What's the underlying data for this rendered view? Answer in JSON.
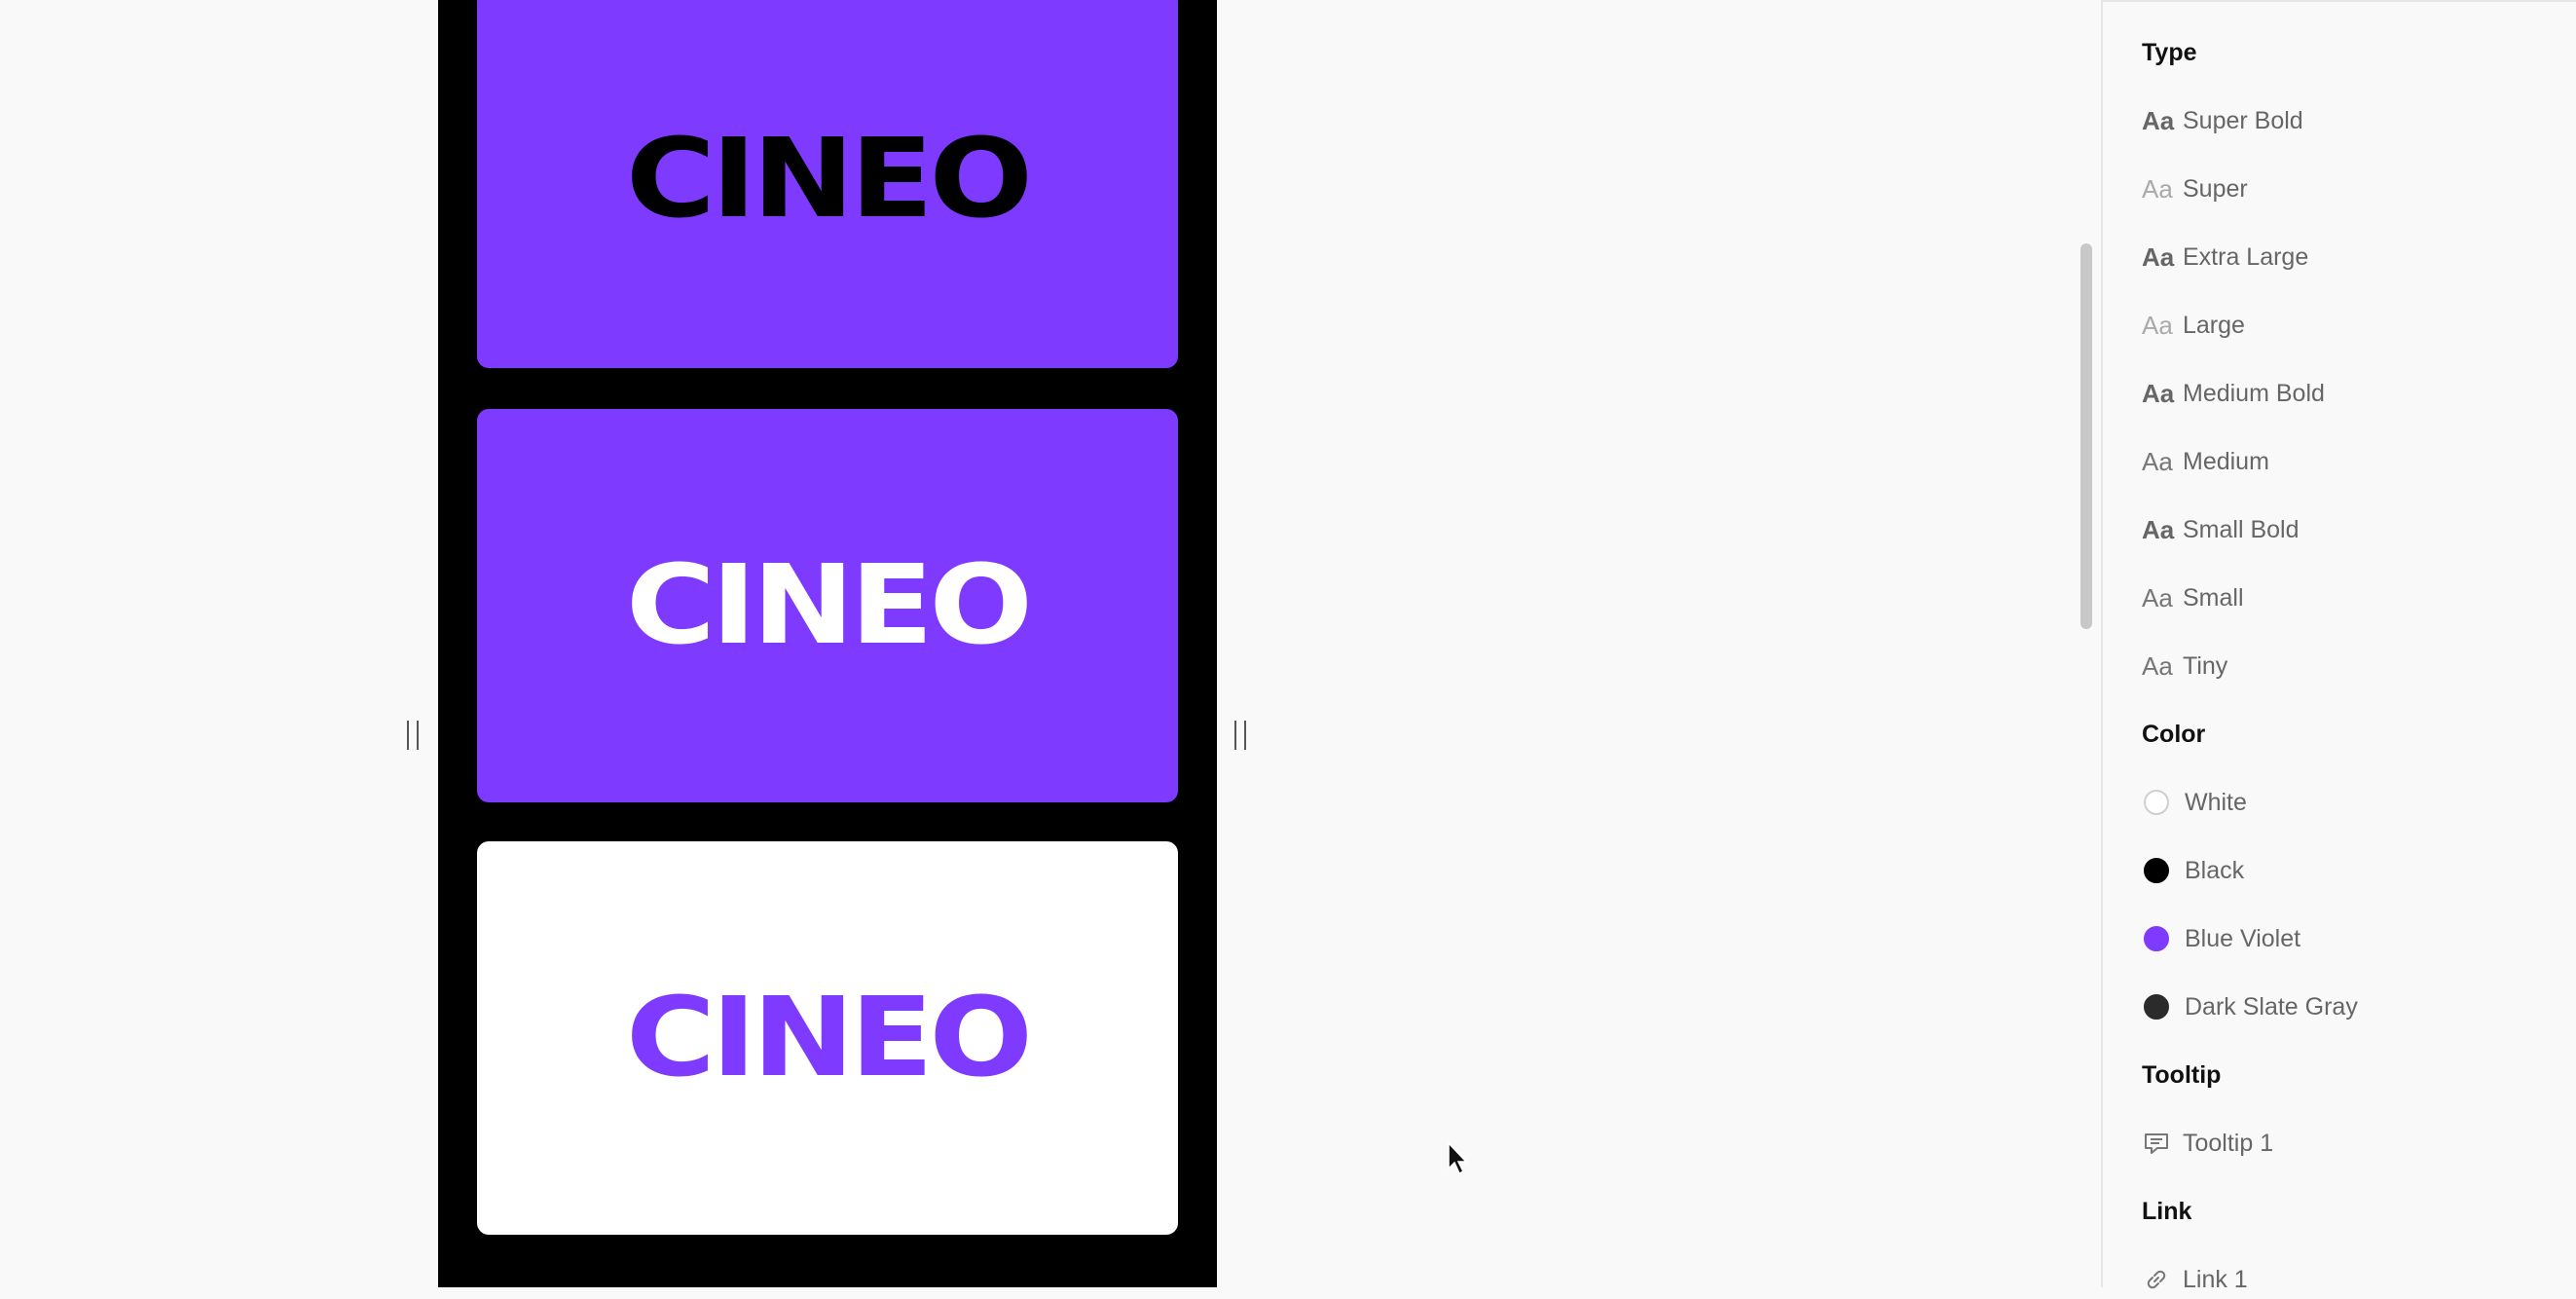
{
  "preview": {
    "cards": [
      {
        "text": "CINEO",
        "bg": "#7f3aff",
        "fg": "#000000"
      },
      {
        "text": "CINEO",
        "bg": "#7f3aff",
        "fg": "#ffffff"
      },
      {
        "text": "CINEO",
        "bg": "#ffffff",
        "fg": "#7f3aff"
      }
    ]
  },
  "panel": {
    "type_title": "Type",
    "type_items": [
      {
        "aa": "Aa",
        "label": "Super Bold"
      },
      {
        "aa": "Aa",
        "label": "Super"
      },
      {
        "aa": "Aa",
        "label": "Extra Large"
      },
      {
        "aa": "Aa",
        "label": "Large"
      },
      {
        "aa": "Aa",
        "label": "Medium Bold"
      },
      {
        "aa": "Aa",
        "label": "Medium"
      },
      {
        "aa": "Aa",
        "label": "Small Bold"
      },
      {
        "aa": "Aa",
        "label": "Small"
      },
      {
        "aa": "Aa",
        "label": "Tiny"
      }
    ],
    "color_title": "Color",
    "color_items": [
      {
        "label": "White",
        "hex": "#ffffff"
      },
      {
        "label": "Black",
        "hex": "#000000"
      },
      {
        "label": "Blue Violet",
        "hex": "#7f3aff"
      },
      {
        "label": "Dark Slate Gray",
        "hex": "#2b2b2b"
      }
    ],
    "tooltip_title": "Tooltip",
    "tooltip_items": [
      {
        "label": "Tooltip 1",
        "icon": "comment-icon"
      }
    ],
    "link_title": "Link",
    "link_items": [
      {
        "label": "Link 1",
        "icon": "link-icon"
      }
    ]
  }
}
